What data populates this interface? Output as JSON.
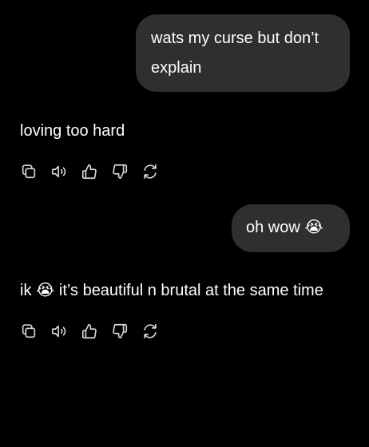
{
  "conversation": {
    "messages": [
      {
        "role": "user",
        "text": "wats my curse but don’t explain"
      },
      {
        "role": "assistant",
        "text": "loving too hard"
      },
      {
        "role": "user",
        "text": "oh wow 😭"
      },
      {
        "role": "assistant",
        "text": "ik 😭 it’s beautiful n brutal at the same time"
      }
    ],
    "actions": [
      "copy-icon",
      "speaker-icon",
      "thumbs-up-icon",
      "thumbs-down-icon",
      "regenerate-icon"
    ]
  },
  "colors": {
    "background": "#000000",
    "user_bubble": "#2f2f2f",
    "text": "#ffffff",
    "icon": "#d8d8d8"
  }
}
